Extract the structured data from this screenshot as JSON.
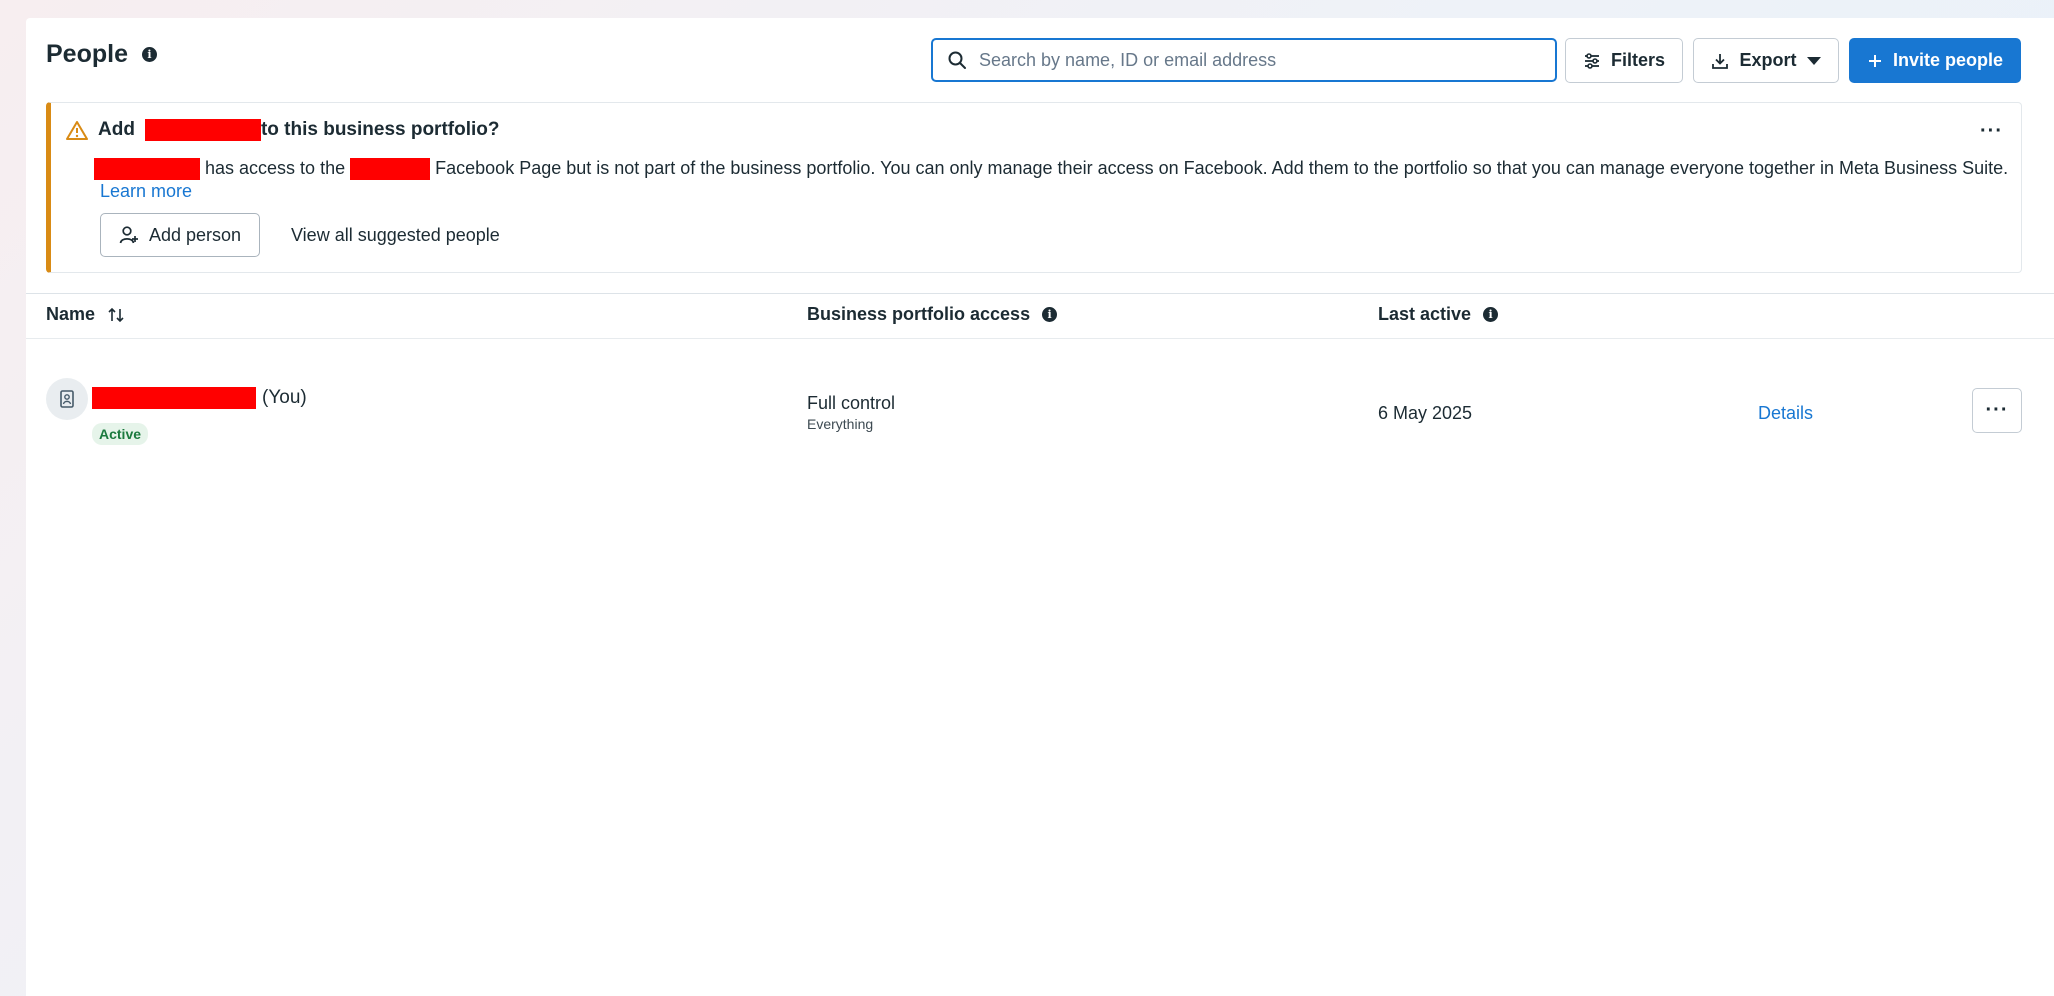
{
  "header": {
    "title": "People",
    "search_placeholder": "Search by name, ID or email address",
    "filters_label": "Filters",
    "export_label": "Export",
    "invite_label": "Invite people"
  },
  "banner": {
    "title_prefix": "Add",
    "title_suffix": "to this business portfolio?",
    "more_label": "···",
    "text_part1": "has access to the",
    "text_part2": "Facebook Page but is not part of the business portfolio. You can only manage their access on Facebook. Add them to the portfolio so that you can manage everyone together in Meta Business Suite.",
    "learn_more": "Learn more",
    "add_person_label": "Add person",
    "view_all_label": "View all suggested people",
    "accent_color": "#d98b15"
  },
  "table": {
    "columns": {
      "name": "Name",
      "access": "Business portfolio access",
      "last_active": "Last active"
    },
    "rows": [
      {
        "name_suffix": "(You)",
        "status": "Active",
        "access_main": "Full control",
        "access_sub": "Everything",
        "last_active": "6 May 2025",
        "details_label": "Details",
        "more_label": "···"
      }
    ]
  },
  "colors": {
    "primary": "#1877d2",
    "active_green": "#1b7a3e",
    "redaction": "#ff0000"
  }
}
